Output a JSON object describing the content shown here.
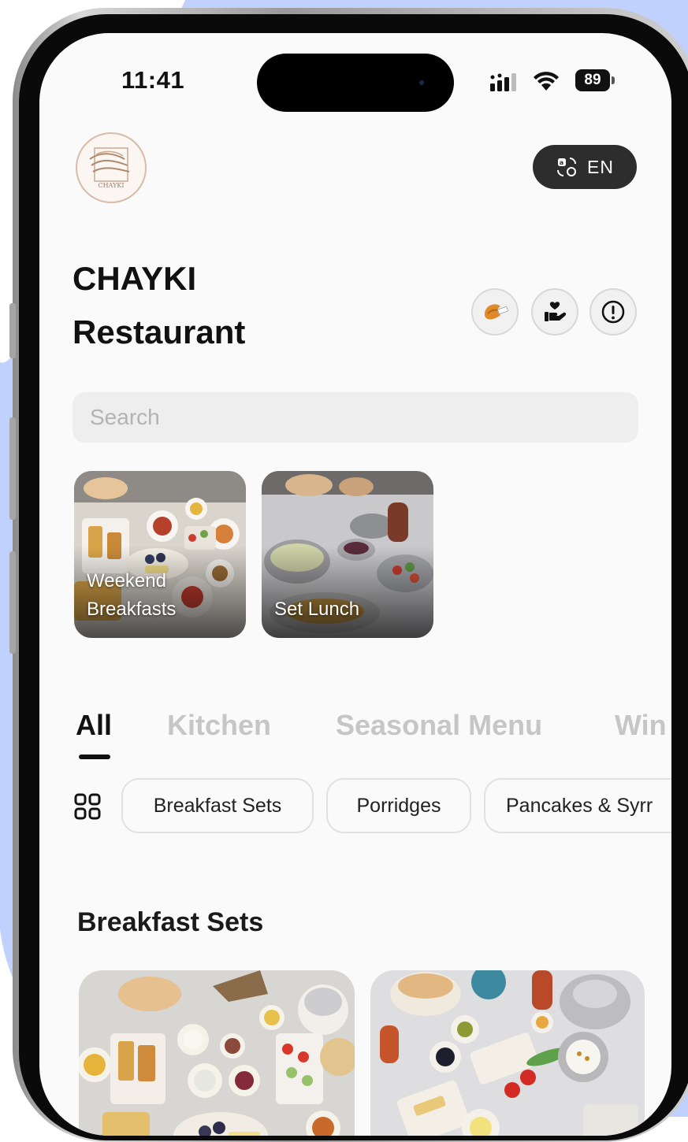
{
  "status_bar": {
    "time": "11:41",
    "battery": "89"
  },
  "header": {
    "logo_text": "CHAYKI",
    "language_label": "EN"
  },
  "restaurant": {
    "name_line1": "CHAYKI",
    "name_line2": "Restaurant"
  },
  "search": {
    "placeholder": "Search"
  },
  "promos": [
    {
      "label": "Weekend\nBreakfasts"
    },
    {
      "label": "Set Lunch"
    }
  ],
  "tabs": [
    {
      "label": "All",
      "active": true
    },
    {
      "label": "Kitchen"
    },
    {
      "label": "Seasonal Menu"
    },
    {
      "label": "Win"
    }
  ],
  "chips": [
    {
      "label": "Breakfast Sets"
    },
    {
      "label": "Porridges"
    },
    {
      "label": "Pancakes & Syrr"
    }
  ],
  "section": {
    "title": "Breakfast Sets"
  },
  "colors": {
    "background_blob": "#c1d1fd",
    "accent_dark": "#2d2d2d",
    "logo_tan": "#c9a891"
  },
  "icons": [
    "fortune-cookie-icon",
    "charity-hand-icon",
    "info-icon",
    "translate-icon",
    "grid-icon",
    "signal-icon",
    "wifi-icon"
  ]
}
